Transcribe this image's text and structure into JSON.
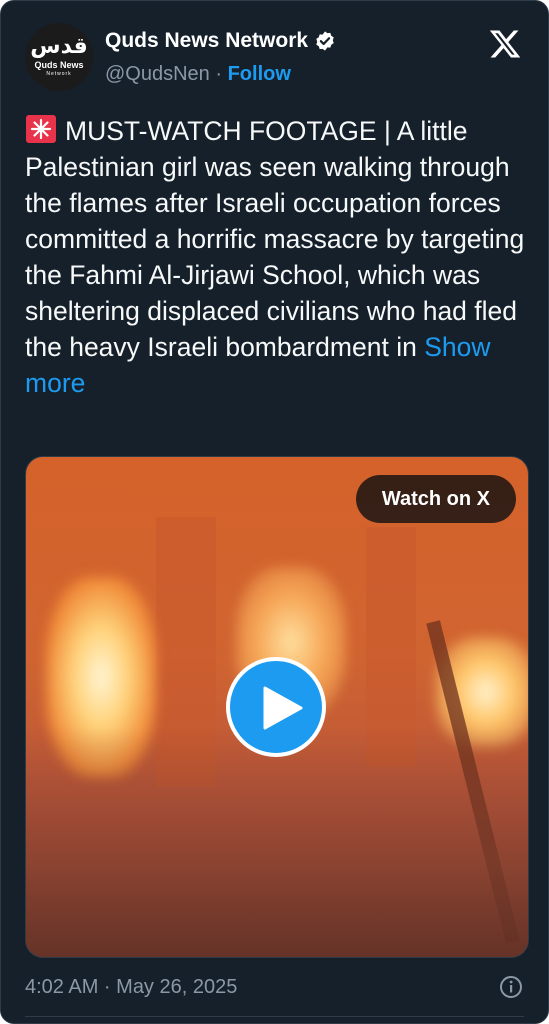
{
  "profile": {
    "avatar_ar": "قدس",
    "avatar_line1": "Quds News",
    "avatar_line2": "Network",
    "name": "Quds News Network",
    "handle": "@QudsNen",
    "separator": " · ",
    "follow_label": "Follow"
  },
  "tweet": {
    "emoji": "siren-icon",
    "text": "MUST-WATCH FOOTAGE | A little Palestinian girl was seen walking through the flames after Israeli occupation forces committed a horrific massacre by targeting the Fahmi Al-Jirjawi School, which was sheltering displaced civilians who had fled the heavy Israeli bombardment in ",
    "show_more_label": "Show more"
  },
  "media": {
    "watch_label": "Watch on X"
  },
  "footer": {
    "timestamp": "4:02 AM · May 26, 2025"
  },
  "colors": {
    "background": "#15202b",
    "accent": "#1d9bf0",
    "muted": "#8b98a5",
    "text": "#f7f9f9"
  }
}
